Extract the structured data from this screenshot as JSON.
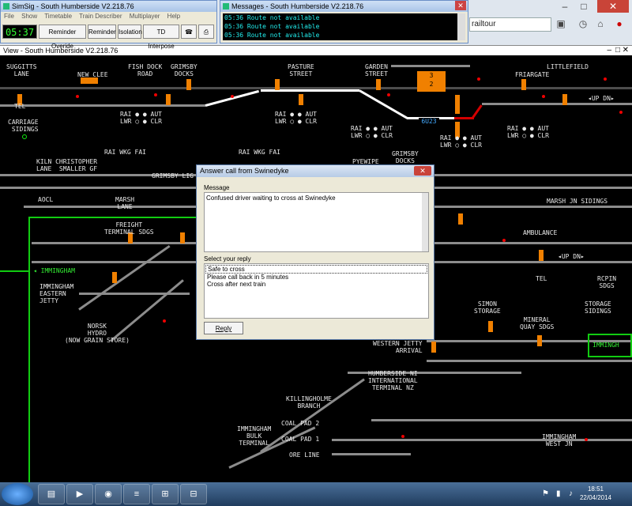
{
  "browser": {
    "address_text": "railtour",
    "tab_close": "×"
  },
  "view_window": {
    "title": "View - South Humberside V2.218.76"
  },
  "control_window": {
    "title": "SimSig - South Humberside V2.218.76",
    "menu": [
      "File",
      "Show",
      "Timetable",
      "Train Describer",
      "Multiplayer",
      "Help"
    ],
    "clock": "05:37",
    "buttons": [
      "Reminder Overide",
      "Reminder",
      "Isolation",
      "TD Interpose"
    ]
  },
  "messages_window": {
    "title": "Messages - South Humberside V2.218.76",
    "lines": [
      "05:36 Route not available",
      "05:36 Route not available",
      "05:36 Route not available"
    ]
  },
  "dialog": {
    "title": "Answer call from Swinedyke",
    "message_label": "Message",
    "message_text": "Confused driver waiting to cross at Swinedyke",
    "reply_label": "Select your reply",
    "replies": [
      "Safe to cross",
      "Please call back in 5 minutes",
      "Cross after next train"
    ],
    "selected_reply": "Safe to cross",
    "reply_button": "Reply"
  },
  "panel": {
    "labels": {
      "suggitts_lane": "SUGGITTS\nLANE",
      "new_clee": "NEW CLEE",
      "fish_dock_road": "FISH DOCK\nROAD",
      "grimsby_docks_top": "GRIMSBY\nDOCKS",
      "pasture_street": "PASTURE\nSTREET",
      "garden_street": "GARDEN\nSTREET",
      "friargate": "FRIARGATE",
      "littlefield": "LITTLEFIELD",
      "tel_left": "TEL",
      "carriage_sidings": "CARRIAGE\n SIDINGS",
      "up_dn_right": "◂UP DN▸",
      "kiln_lane": "KILN CHRISTOPHER\nLANE  SMALLER GF",
      "pyewipe": "PYEWIPE",
      "grimsby_docks_mid": "GRIMSBY\nDOCKS",
      "grimsby_lig": "GRIMSBY LIG",
      "aocl": "AOCL",
      "marsh_lane": "MARSH\nLANE",
      "marsh_jn_sidings": "MARSH JN SIDINGS",
      "freight_terminal": "FREIGHT\nTERMINAL SDGS",
      "ambulance": "AMBULANCE",
      "up_dn_mid": "◂UP DN▸",
      "immingham_green": "◂ IMMINGHAM",
      "immingham_eastern": "IMMINGHAM\nEASTERN\nJETTY",
      "tel_right": "TEL",
      "rcpin_sdgs": "RCPIN\nSDGS",
      "norsk_hydro": "NORSK\nHYDRO\n(NOW GRAIN STORE)",
      "simon_storage": "SIMON\nSTORAGE",
      "mineral_quay": "MINERAL\nQUAY SDGS",
      "storage_sidings": "STORAGE\nSIDINGS",
      "western_jetty": "WESTERN JETTY\nARRIVAL",
      "humberside": "HUMBERSIDE NI\nINTERNATIONAL\nTERMINAL NZ",
      "killingholme": "KILLINGHOLME\nBRANCH",
      "coal_pad_2": "COAL PAD 2",
      "coal_pad_1": "COAL PAD 1",
      "ore_line": "ORE LINE",
      "immingham_bulk": "IMMINGHAM\nBULK\nTERMINAL",
      "immingham_west": "IMMINGHAM\nWEST JN",
      "immingham_box": "IMMINGH",
      "berth": "6U23",
      "berth_box": "3\n2",
      "rai_aut_label": "RAI ● ● AUT\nLWR ○ ● CLR",
      "rai_wkg_fai": "RAI WKG FAI"
    },
    "colors": {
      "track": "#8c8c8c",
      "route_set": "#ffffff",
      "occupied": "#d40000",
      "signal": "#f08000",
      "green_line": "#11cc11"
    }
  },
  "taskbar": {
    "time": "18:51",
    "date": "22/04/2014",
    "apps": [
      "explorer",
      "media",
      "firefox",
      "simsig-1",
      "simsig-2",
      "simsig-3"
    ]
  }
}
